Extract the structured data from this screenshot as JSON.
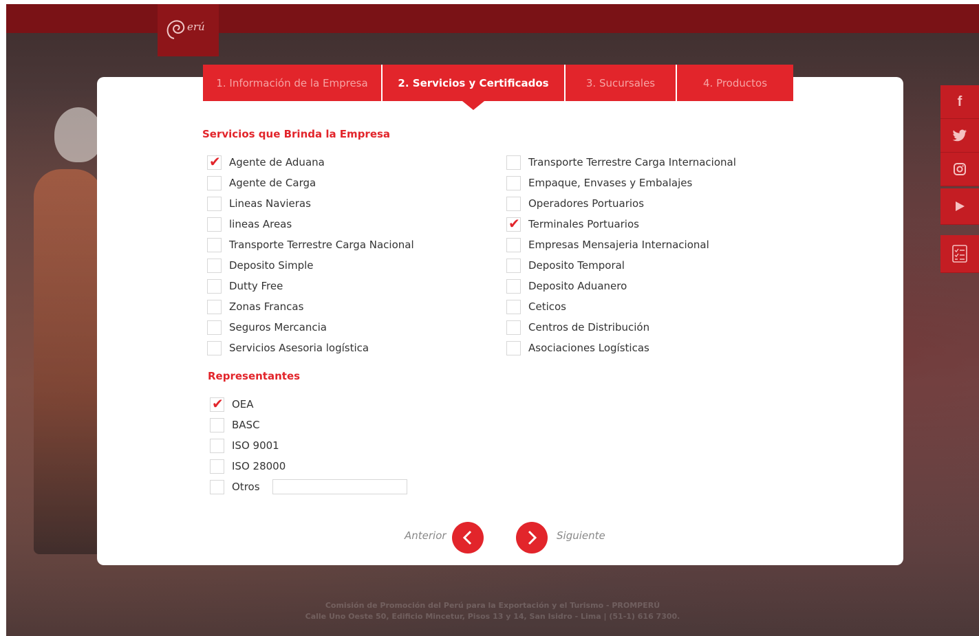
{
  "brand": {
    "logo_text": "erú"
  },
  "tabs": [
    {
      "label": "1. Información de la Empresa",
      "active": false
    },
    {
      "label": "2. Servicios y Certificados",
      "active": true
    },
    {
      "label": "3. Sucursales",
      "active": false
    },
    {
      "label": "4. Productos",
      "active": false
    }
  ],
  "services": {
    "title": "Servicios que Brinda la Empresa",
    "left": [
      {
        "label": "Agente de Aduana",
        "checked": true
      },
      {
        "label": "Agente de Carga",
        "checked": false
      },
      {
        "label": "Lineas Navieras",
        "checked": false
      },
      {
        "label": "lineas Areas",
        "checked": false
      },
      {
        "label": "Transporte Terrestre Carga Nacional",
        "checked": false
      },
      {
        "label": "Deposito Simple",
        "checked": false
      },
      {
        "label": "Dutty Free",
        "checked": false
      },
      {
        "label": "Zonas Francas",
        "checked": false
      },
      {
        "label": "Seguros Mercancia",
        "checked": false
      },
      {
        "label": "Servicios Asesoria logística",
        "checked": false
      }
    ],
    "right": [
      {
        "label": "Transporte Terrestre Carga Internacional",
        "checked": false
      },
      {
        "label": "Empaque, Envases y Embalajes",
        "checked": false
      },
      {
        "label": "Operadores Portuarios",
        "checked": false
      },
      {
        "label": "Terminales Portuarios",
        "checked": true
      },
      {
        "label": "Empresas Mensajeria Internacional",
        "checked": false
      },
      {
        "label": "Deposito Temporal",
        "checked": false
      },
      {
        "label": "Deposito Aduanero",
        "checked": false
      },
      {
        "label": "Ceticos",
        "checked": false
      },
      {
        "label": "Centros de Distribución",
        "checked": false
      },
      {
        "label": "Asociaciones Logísticas",
        "checked": false
      }
    ]
  },
  "representantes": {
    "title": "Representantes",
    "items": [
      {
        "label": "OEA",
        "checked": true
      },
      {
        "label": "BASC",
        "checked": false
      },
      {
        "label": "ISO 9001",
        "checked": false
      },
      {
        "label": "ISO 28000",
        "checked": false
      },
      {
        "label": "Otros",
        "checked": false
      }
    ],
    "otros_value": ""
  },
  "nav": {
    "prev_label": "Anterior",
    "next_label": "Siguiente"
  },
  "social": [
    "facebook-icon",
    "twitter-icon",
    "instagram-icon",
    "youtube-icon",
    "checklist-icon"
  ],
  "footer": {
    "line1": "Comisión de Promoción del Perú para la Exportación y el Turismo - PROMPERÚ",
    "line2": "Calle Uno Oeste 50, Edificio Mincetur, Pisos 13 y 14, San Isidro - Lima | (51-1) 616 7300."
  },
  "colors": {
    "accent": "#e2252b",
    "topbar": "#7a1216"
  }
}
